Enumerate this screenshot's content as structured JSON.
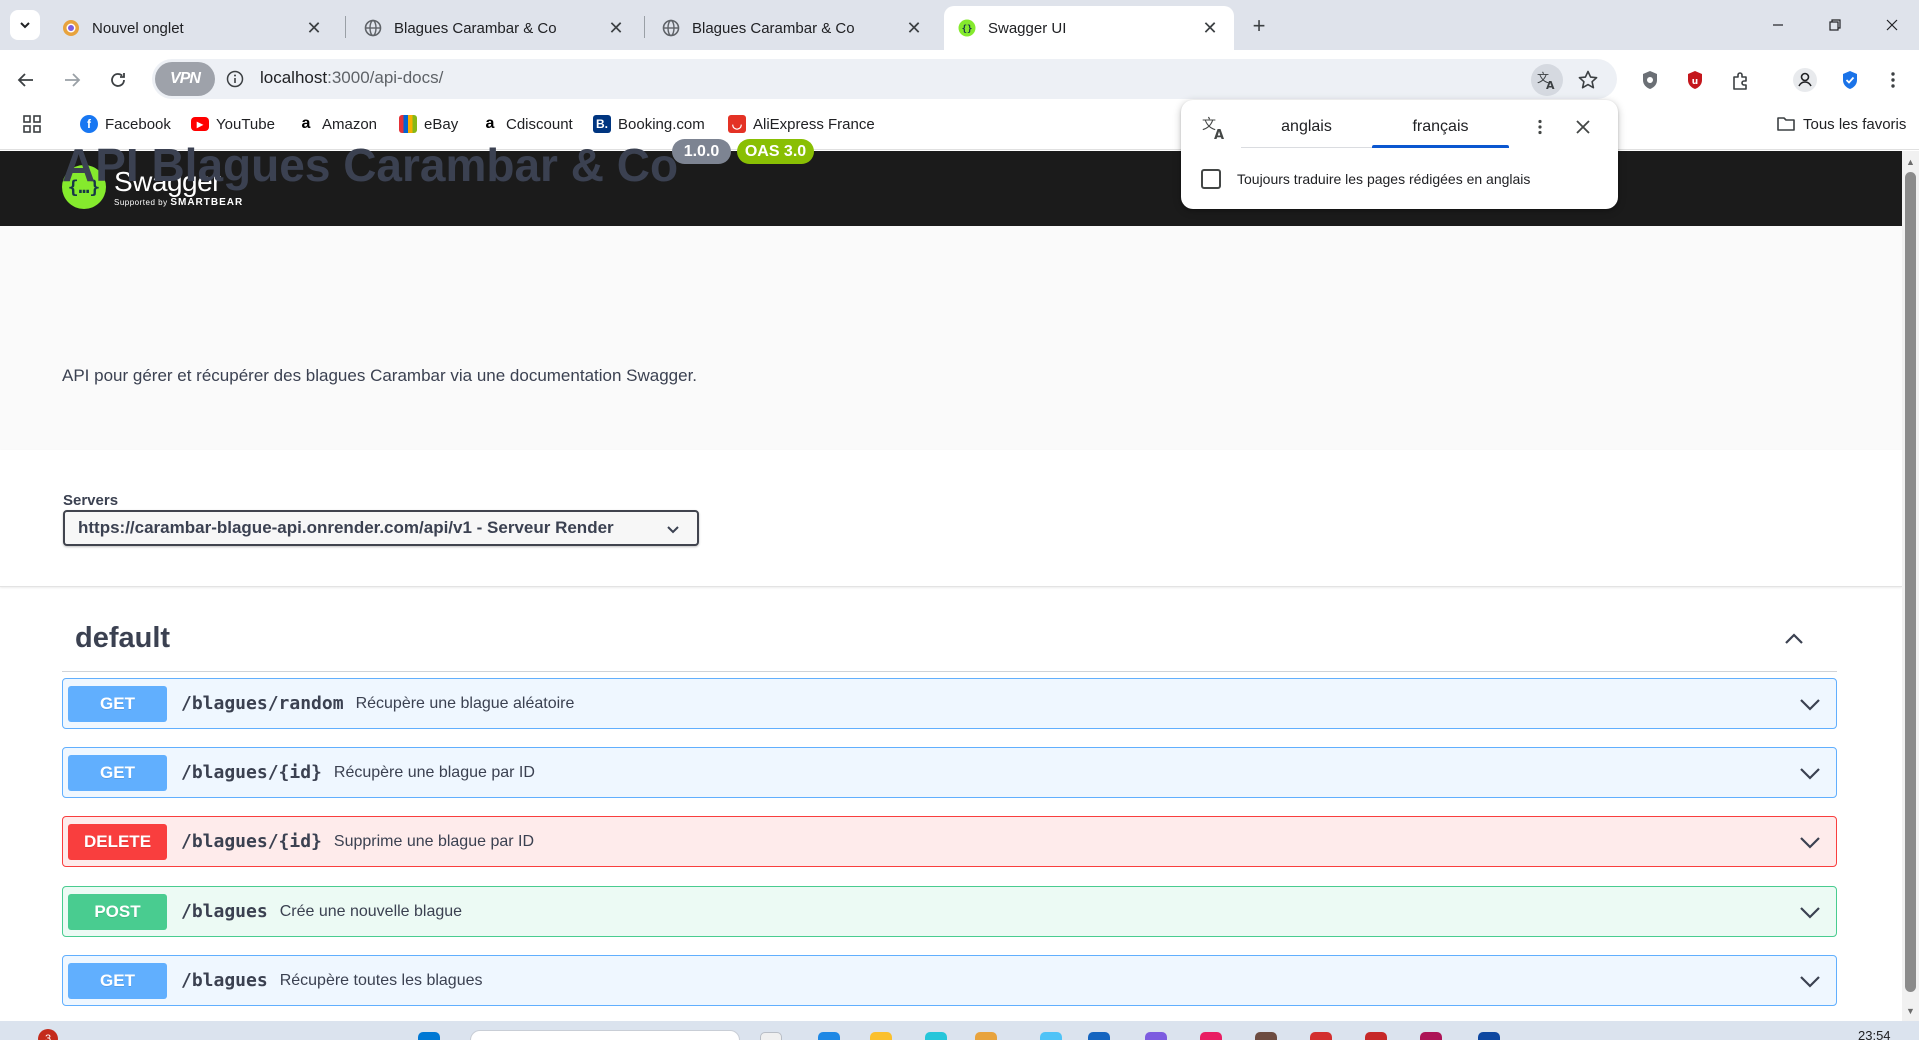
{
  "browser": {
    "tabs": [
      {
        "title": "Nouvel onglet",
        "favicon": "chromium-icon",
        "active": false
      },
      {
        "title": "Blagues Carambar & Co",
        "favicon": "globe-icon",
        "active": false
      },
      {
        "title": "Blagues Carambar & Co",
        "favicon": "globe-icon",
        "active": false
      },
      {
        "title": "Swagger UI",
        "favicon": "swagger-icon",
        "active": true
      }
    ],
    "vpn_label": "VPN",
    "url_host": "localhost",
    "url_path": ":3000/api-docs/",
    "bookmarks": [
      {
        "label": "Facebook",
        "icon": "facebook-icon",
        "color": "#1877f2"
      },
      {
        "label": "YouTube",
        "icon": "youtube-icon",
        "color": "#ff0000"
      },
      {
        "label": "Amazon",
        "icon": "amazon-icon",
        "color": "#000000"
      },
      {
        "label": "eBay",
        "icon": "ebay-icon",
        "color": "#e53238"
      },
      {
        "label": "Cdiscount",
        "icon": "cdiscount-icon",
        "color": "#000000"
      },
      {
        "label": "Booking.com",
        "icon": "booking-icon",
        "color": "#003580"
      },
      {
        "label": "AliExpress France",
        "icon": "aliexpress-icon",
        "color": "#e43225"
      }
    ],
    "all_bookmarks": "Tous les favoris"
  },
  "translate_popup": {
    "source_lang": "anglais",
    "target_lang": "français",
    "always_translate_label": "Toujours traduire les pages rédigées en anglais",
    "always_translate_checked": false
  },
  "swagger": {
    "logo_text": "Swagger",
    "logo_sub": "Supported by",
    "logo_sub_brand": "SMARTBEAR",
    "title": "API Blagues Carambar & Co",
    "version_badge": "1.0.0",
    "oas_badge": "OAS 3.0",
    "description": "API pour gérer et récupérer des blagues Carambar via une documentation Swagger.",
    "servers_label": "Servers",
    "selected_server": "https://carambar-blague-api.onrender.com/api/v1 - Serveur Render",
    "tag_name": "default",
    "operations": [
      {
        "method": "GET",
        "path": "/blagues/random",
        "summary": "Récupère une blague aléatoire"
      },
      {
        "method": "GET",
        "path": "/blagues/{id}",
        "summary": "Récupère une blague par ID"
      },
      {
        "method": "DELETE",
        "path": "/blagues/{id}",
        "summary": "Supprime une blague par ID"
      },
      {
        "method": "POST",
        "path": "/blagues",
        "summary": "Crée une nouvelle blague"
      },
      {
        "method": "GET",
        "path": "/blagues",
        "summary": "Récupère toutes les blagues"
      }
    ]
  },
  "taskbar": {
    "notification_count": "3",
    "clock": "23:54"
  },
  "colors": {
    "get": "#61affe",
    "delete": "#f93e3e",
    "post": "#49cc90",
    "swagger_green": "#85ea2d",
    "version_badge": "#7d8492",
    "oas_badge": "#89bf04"
  }
}
